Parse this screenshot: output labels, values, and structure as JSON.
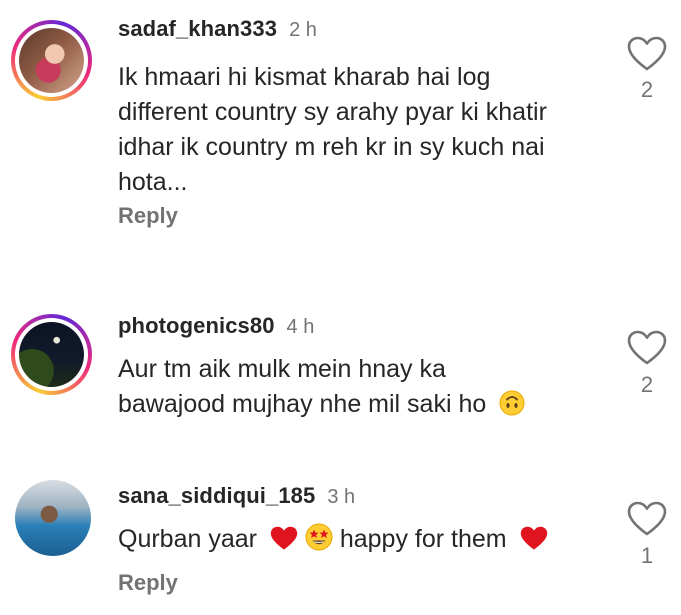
{
  "comments": [
    {
      "username": "sadaf_khan333",
      "time": "2 h",
      "text_lines": [
        "Ik hmaari hi kismat kharab hai log",
        "different country sy arahy pyar ki khatir",
        "idhar ik country m reh kr in sy kuch nai",
        "hota..."
      ],
      "reply_label": "Reply",
      "likes": "2",
      "avatar": "profile-photo-woman"
    },
    {
      "username": "photogenics80",
      "time": "4 h",
      "text_lines": [
        "Aur tm aik mulk mein hnay ka",
        "bawajood mujhay nhe mil saki ho"
      ],
      "emoji": "upside-down-face",
      "likes": "2",
      "avatar": "profile-photo-night-sky"
    },
    {
      "username": "sana_siddiqui_185",
      "time": "3 h",
      "text_parts": [
        "Qurban yaar",
        "happy for them"
      ],
      "emojis": [
        "red-heart",
        "star-struck",
        "red-heart"
      ],
      "reply_label": "Reply",
      "likes": "1",
      "avatar": "profile-photo-pool"
    }
  ],
  "colors": {
    "text": "#262626",
    "secondary": "#737373",
    "heart_red": "#e0141e",
    "emoji_yellow": "#ffcc33"
  }
}
